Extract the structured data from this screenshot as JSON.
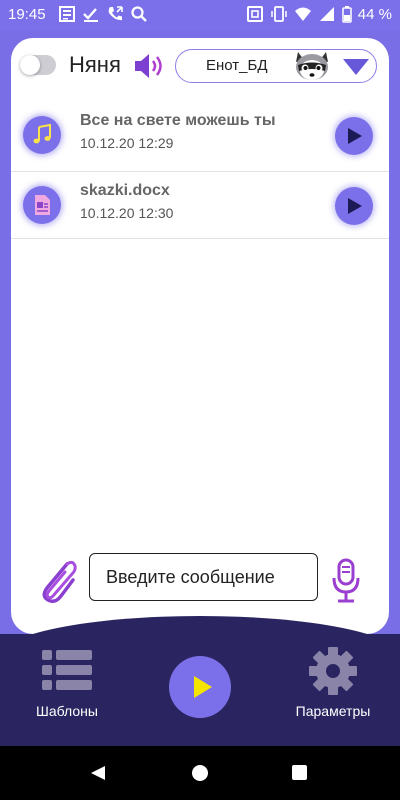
{
  "status_bar": {
    "time": "19:45",
    "battery": "44 %"
  },
  "header": {
    "nanny_label": "Няня",
    "toggle_on": false,
    "device_name": "Енот_БД"
  },
  "messages": [
    {
      "title": "Все на свете можешь ты",
      "date": "10.12.20 12:29",
      "icon": "music-note-icon"
    },
    {
      "title": "skazki.docx",
      "date": "10.12.20 12:30",
      "icon": "document-file-icon"
    }
  ],
  "composer": {
    "placeholder": "Введите сообщение"
  },
  "bottom_nav": {
    "templates_label": "Шаблоны",
    "settings_label": "Параметры"
  },
  "colors": {
    "accent": "#7c70ea",
    "bottom_bar": "#2a2560",
    "play_triangle": "#f5e400"
  }
}
